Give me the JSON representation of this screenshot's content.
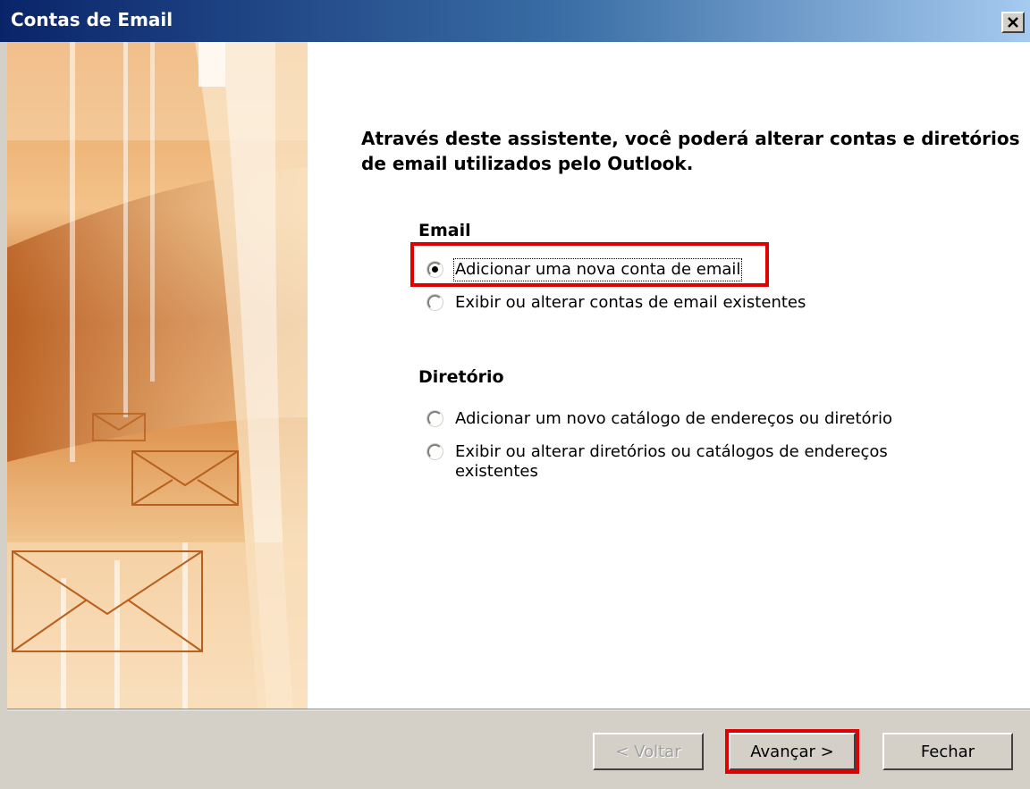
{
  "window": {
    "title": "Contas de Email"
  },
  "icons": {
    "close": "close-icon",
    "envelope": "envelope-icon"
  },
  "colors": {
    "highlight": "#e00000",
    "title_bar_start": "#0a246a",
    "title_bar_end": "#a6caf0"
  },
  "intro_text": "Através deste assistente, você poderá alterar contas e diretórios de email utilizados pelo Outlook.",
  "email_section": {
    "title": "Email",
    "options": [
      {
        "label": "Adicionar uma nova conta de email",
        "checked": true
      },
      {
        "label": "Exibir ou alterar contas de email existentes",
        "checked": false
      }
    ]
  },
  "directory_section": {
    "title": "Diretório",
    "options": [
      {
        "label": "Adicionar um novo catálogo de endereços ou diretório",
        "checked": false
      },
      {
        "label": "Exibir ou alterar diretórios ou catálogos de endereços existentes",
        "checked": false
      }
    ]
  },
  "buttons": {
    "back": {
      "label": "< Voltar",
      "enabled": false
    },
    "next": {
      "label": "Avançar >",
      "enabled": true
    },
    "close": {
      "label": "Fechar",
      "enabled": true
    }
  }
}
